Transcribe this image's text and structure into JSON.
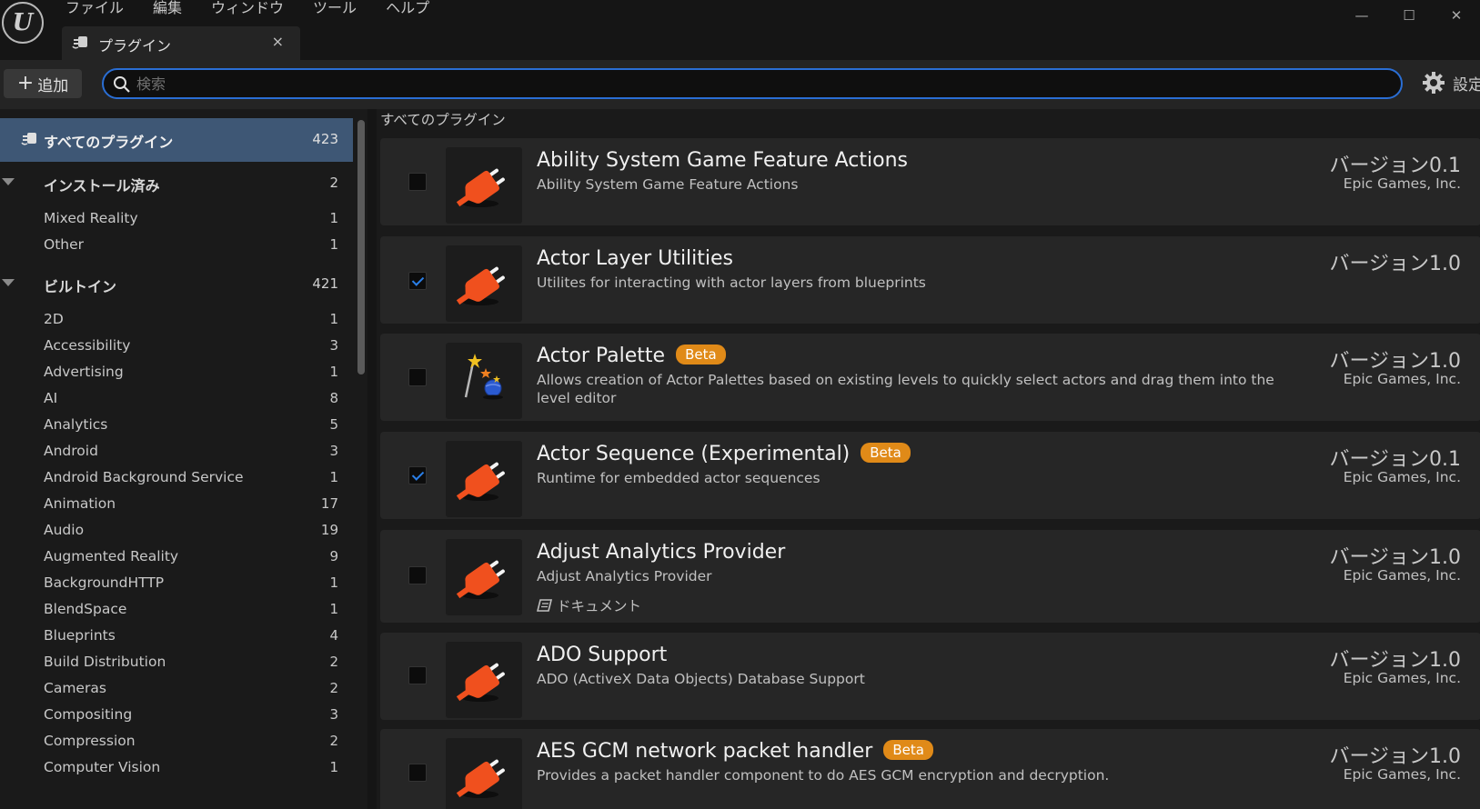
{
  "menu": [
    "ファイル",
    "編集",
    "ウィンドウ",
    "ツール",
    "ヘルプ"
  ],
  "tab": {
    "label": "プラグイン",
    "close": "×"
  },
  "window_buttons": {
    "minimize": "—",
    "maximize": "☐",
    "close": "✕"
  },
  "toolbar": {
    "add_label": "追加",
    "search_placeholder": "検索",
    "settings_label": "設定"
  },
  "sidebar": {
    "all": {
      "label": "すべてのプラグイン",
      "count": "423"
    },
    "installed": {
      "label": "インストール済み",
      "count": "2"
    },
    "installed_items": [
      {
        "label": "Mixed Reality",
        "count": "1"
      },
      {
        "label": "Other",
        "count": "1"
      }
    ],
    "builtin": {
      "label": "ビルトイン",
      "count": "421"
    },
    "builtin_items": [
      {
        "label": "2D",
        "count": "1"
      },
      {
        "label": "Accessibility",
        "count": "3"
      },
      {
        "label": "Advertising",
        "count": "1"
      },
      {
        "label": "AI",
        "count": "8"
      },
      {
        "label": "Analytics",
        "count": "5"
      },
      {
        "label": "Android",
        "count": "3"
      },
      {
        "label": "Android Background Service",
        "count": "1"
      },
      {
        "label": "Animation",
        "count": "17"
      },
      {
        "label": "Audio",
        "count": "19"
      },
      {
        "label": "Augmented Reality",
        "count": "9"
      },
      {
        "label": "BackgroundHTTP",
        "count": "1"
      },
      {
        "label": "BlendSpace",
        "count": "1"
      },
      {
        "label": "Blueprints",
        "count": "4"
      },
      {
        "label": "Build Distribution",
        "count": "2"
      },
      {
        "label": "Cameras",
        "count": "2"
      },
      {
        "label": "Compositing",
        "count": "3"
      },
      {
        "label": "Compression",
        "count": "2"
      },
      {
        "label": "Computer Vision",
        "count": "1"
      }
    ]
  },
  "main": {
    "header": "すべてのプラグイン",
    "plugins": [
      {
        "title": "Ability System Game Feature Actions",
        "badge": "",
        "description": "Ability System Game Feature Actions",
        "version": "バージョン0.1",
        "vendor": "Epic Games, Inc.",
        "doc": "",
        "checked": false,
        "icon": "plug-icon"
      },
      {
        "title": "Actor Layer Utilities",
        "badge": "",
        "description": "Utilites for interacting with actor layers from blueprints",
        "version": "バージョン1.0",
        "vendor": "",
        "doc": "",
        "checked": true,
        "icon": "plug-icon"
      },
      {
        "title": "Actor Palette",
        "badge": "Beta",
        "description": "Allows creation of Actor Palettes based on existing levels to quickly select actors and drag them into the level editor",
        "version": "バージョン1.0",
        "vendor": "Epic Games, Inc.",
        "doc": "",
        "checked": false,
        "icon": "palette-wand-icon"
      },
      {
        "title": "Actor Sequence (Experimental)",
        "badge": "Beta",
        "description": "Runtime for embedded actor sequences",
        "version": "バージョン0.1",
        "vendor": "Epic Games, Inc.",
        "doc": "",
        "checked": true,
        "icon": "plug-icon"
      },
      {
        "title": "Adjust Analytics Provider",
        "badge": "",
        "description": "Adjust Analytics Provider",
        "version": "バージョン1.0",
        "vendor": "Epic Games, Inc.",
        "doc": "ドキュメント",
        "checked": false,
        "icon": "plug-icon"
      },
      {
        "title": "ADO Support",
        "badge": "",
        "description": "ADO (ActiveX Data Objects) Database Support",
        "version": "バージョン1.0",
        "vendor": "Epic Games, Inc.",
        "doc": "",
        "checked": false,
        "icon": "plug-icon"
      },
      {
        "title": "AES GCM network packet handler",
        "badge": "Beta",
        "description": "Provides a packet handler component to do AES GCM encryption and decryption.",
        "version": "バージョン1.0",
        "vendor": "Epic Games, Inc.",
        "doc": "",
        "checked": false,
        "icon": "plug-icon"
      }
    ]
  },
  "colors": {
    "accent": "#2a6ed4",
    "selected_bg": "#3e5775",
    "beta_badge": "#e08a18",
    "plug_orange": "#f0501e"
  }
}
